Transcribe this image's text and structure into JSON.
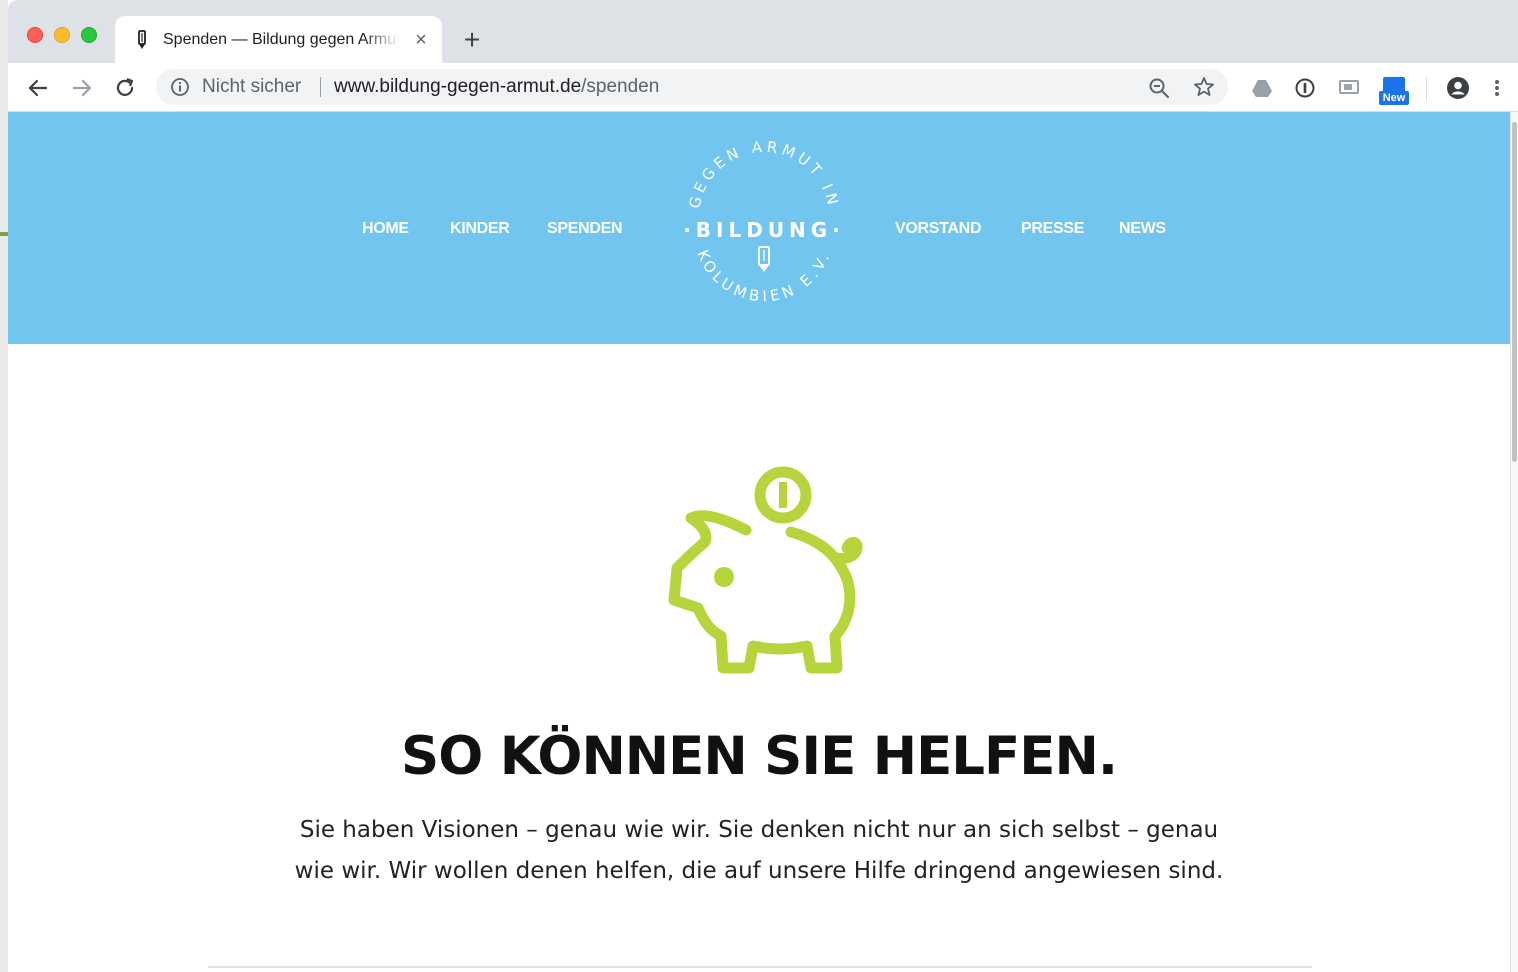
{
  "browser": {
    "tab": {
      "title": "Spenden — Bildung gegen Armut in Kolumbien e.V.",
      "close_icon": "close-icon",
      "favicon": "pencil-icon"
    },
    "new_tab_label": "+",
    "toolbar": {
      "security_text": "Nicht sicher",
      "url_domain": "www.bildung-gegen-armut.de",
      "url_path": "/spenden",
      "ext_new_badge": "New"
    },
    "colors": {
      "tabstrip": "#dee1e6",
      "omnibox": "#f1f3f4",
      "accent_blue": "#1a73e8"
    }
  },
  "site": {
    "colors": {
      "header_bg": "#72c5ee",
      "accent_green": "#b6d53d",
      "text": "#111111"
    },
    "nav": [
      {
        "label": "HOME"
      },
      {
        "label": "KINDER"
      },
      {
        "label": "SPENDEN"
      },
      {
        "label": "VORSTAND"
      },
      {
        "label": "PRESSE"
      },
      {
        "label": "NEWS"
      }
    ],
    "logo": {
      "top_arc": "GEGEN ARMUT IN",
      "center": "·BILDUNG·",
      "bottom_arc": "KOLUMBIEN E.V."
    },
    "hero": {
      "icon": "piggy-bank-icon",
      "headline": "SO KÖNNEN SIE HELFEN.",
      "intro": "Sie haben Visionen – genau wie wir. Sie denken nicht nur an sich selbst – genau wie wir. Wir wollen denen helfen, die auf unsere Hilfe dringend angewiesen sind."
    }
  }
}
